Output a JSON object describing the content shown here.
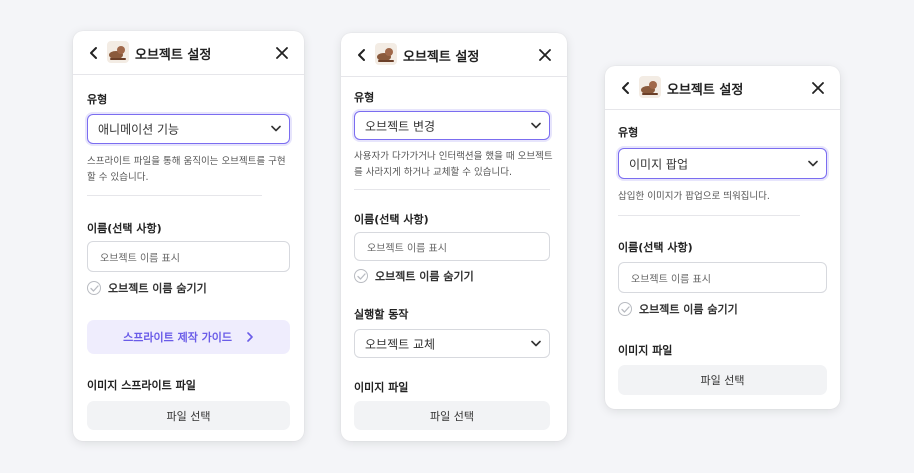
{
  "panels": [
    {
      "header": {
        "title": "오브젝트 설정",
        "thumbnail": "duck-sprite-image"
      },
      "type_label": "유형",
      "type_value": "애니메이션 기능",
      "description": "스프라이트 파일을 통해 움직이는 오브젝트를 구현할 수 있습니다.",
      "name_label": "이름(선택 사항)",
      "name_placeholder": "오브젝트 이름 표시",
      "hide_name_label": "오브젝트 이름 숨기기",
      "guide_label": "스프라이트 제작 가이드",
      "file_label": "이미지 스프라이트 파일",
      "file_button": "파일 선택"
    },
    {
      "header": {
        "title": "오브젝트 설정",
        "thumbnail": "duck-sprite-image"
      },
      "type_label": "유형",
      "type_value": "오브젝트 변경",
      "description": "사용자가 다가가거나 인터랙션을 했을 때 오브젝트를 사라지게 하거나 교체할 수 있습니다.",
      "name_label": "이름(선택 사항)",
      "name_placeholder": "오브젝트 이름 표시",
      "hide_name_label": "오브젝트 이름 숨기기",
      "action_label": "실행할 동작",
      "action_value": "오브젝트 교체",
      "file_label": "이미지 파일",
      "file_button": "파일 선택"
    },
    {
      "header": {
        "title": "오브젝트 설정",
        "thumbnail": "duck-sprite-image"
      },
      "type_label": "유형",
      "type_value": "이미지 팝업",
      "description": "삽입한 이미지가 팝업으로 띄워집니다.",
      "name_label": "이름(선택 사항)",
      "name_placeholder": "오브젝트 이름 표시",
      "hide_name_label": "오브젝트 이름 숨기기",
      "file_label": "이미지 파일",
      "file_button": "파일 선택"
    }
  ],
  "colors": {
    "accent": "#7b6df0",
    "guide_bg": "#efedfd",
    "button_bg": "#f2f3f5",
    "page_bg": "#f4f5f8"
  },
  "icons": [
    "chevron-left-icon",
    "close-icon",
    "chevron-down-icon",
    "check-circle-icon",
    "chevron-right-icon"
  ]
}
